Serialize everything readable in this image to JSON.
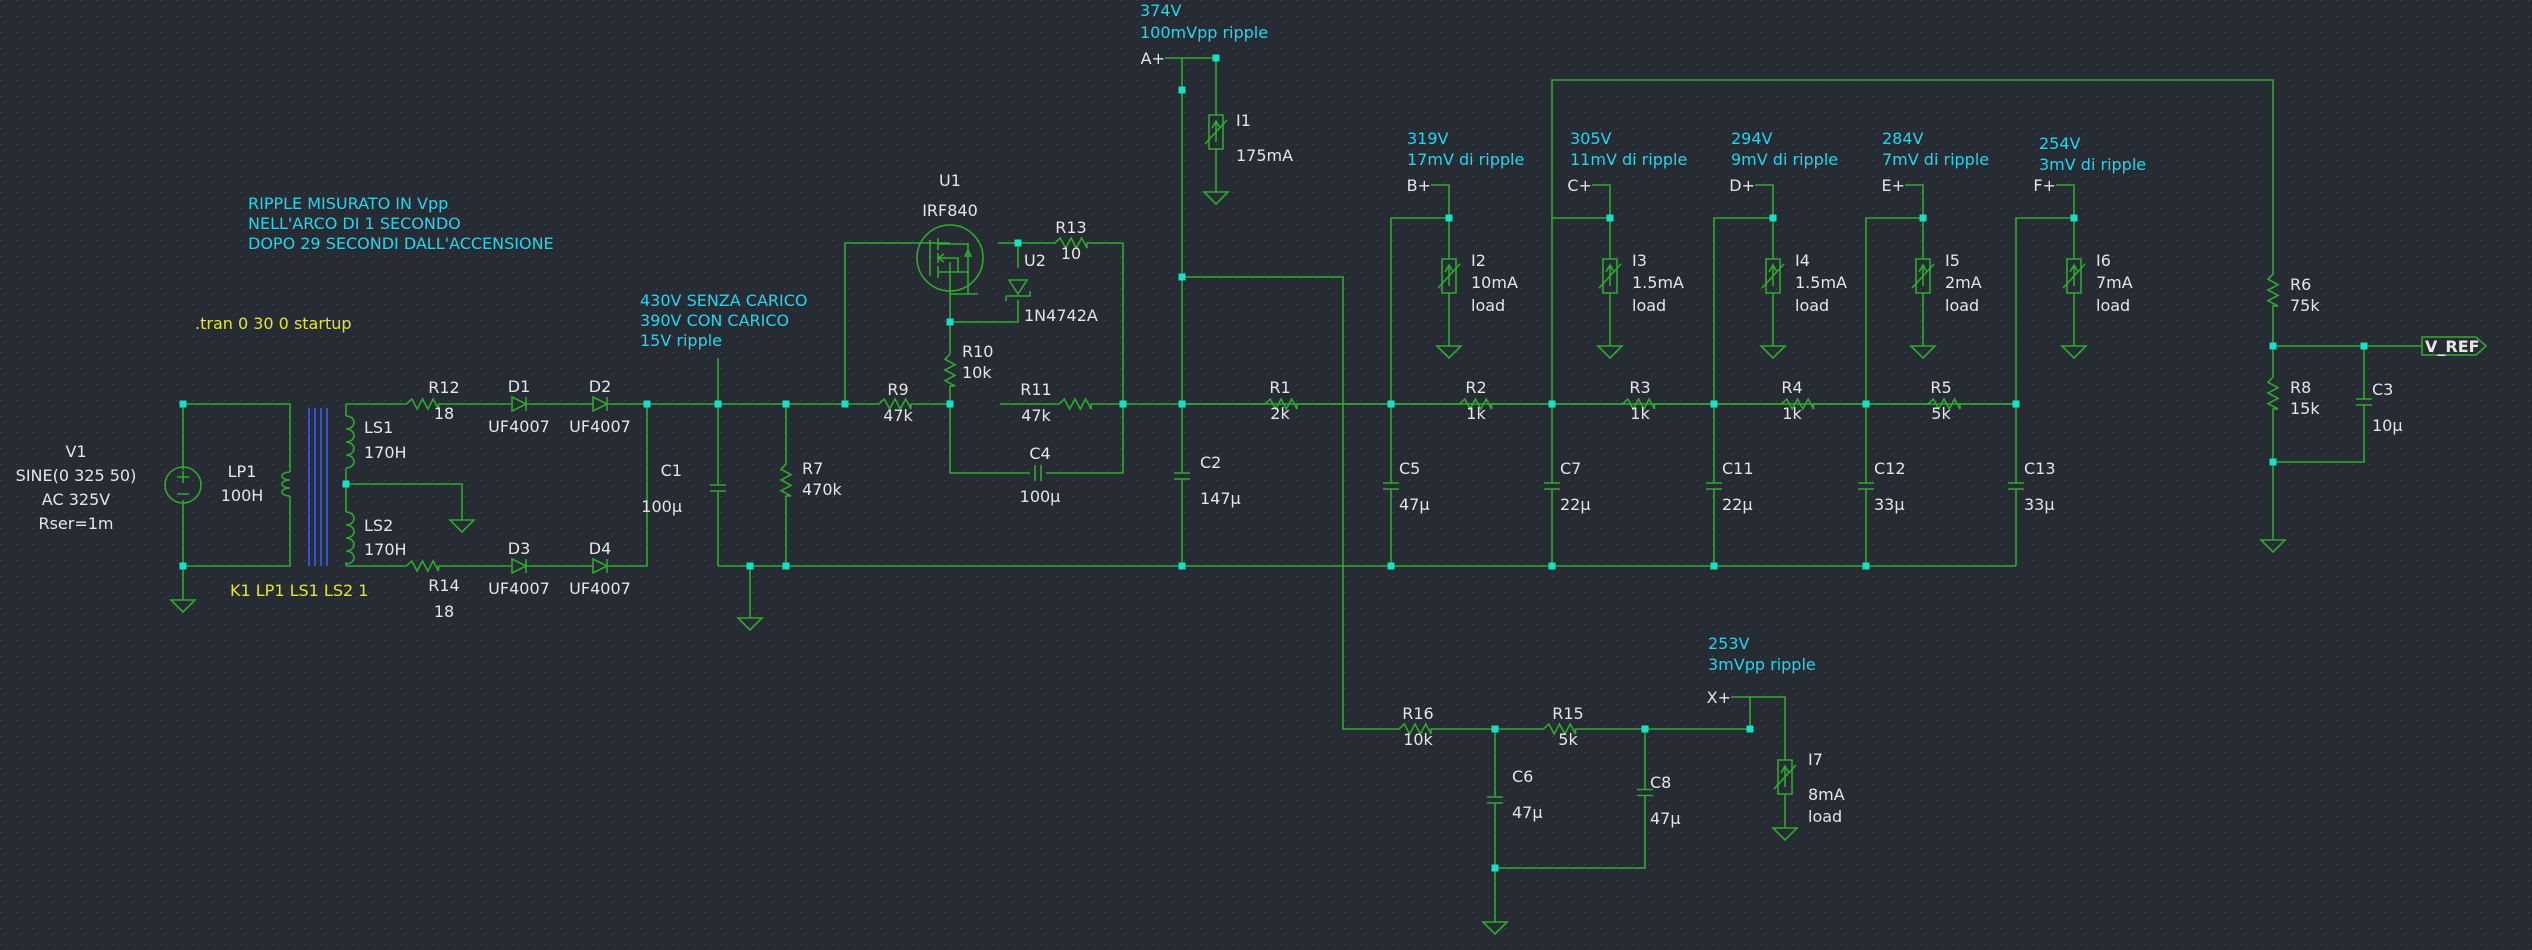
{
  "colors": {
    "background": "#272b33",
    "grid": "#3c424c",
    "wire": "#2eaa2e",
    "node": "#18e0c8",
    "label": "#e6e6e6",
    "note_cyan": "#22d6ee",
    "note_yellow": "#e6e62a",
    "transformer_core": "#3355cc"
  },
  "components": {
    "V1": {
      "name": "V1",
      "l1": "SINE(0 325 50)",
      "l2": "AC 325V",
      "l3": "Rser=1m"
    },
    "LP1": {
      "name": "LP1",
      "value": "100H"
    },
    "LS1": {
      "name": "LS1",
      "value": "170H"
    },
    "LS2": {
      "name": "LS2",
      "value": "170H"
    },
    "R12": {
      "name": "R12",
      "value": "18"
    },
    "R14": {
      "name": "R14",
      "value": "18"
    },
    "D1": {
      "name": "D1",
      "value": "UF4007"
    },
    "D2": {
      "name": "D2",
      "value": "UF4007"
    },
    "D3": {
      "name": "D3",
      "value": "UF4007"
    },
    "D4": {
      "name": "D4",
      "value": "UF4007"
    },
    "C1": {
      "name": "C1",
      "value": "100µ"
    },
    "R7": {
      "name": "R7",
      "value": "470k"
    },
    "R9": {
      "name": "R9",
      "value": "47k"
    },
    "R10": {
      "name": "R10",
      "value": "10k"
    },
    "R11": {
      "name": "R11",
      "value": "47k"
    },
    "R13": {
      "name": "R13",
      "value": "10"
    },
    "C4": {
      "name": "C4",
      "value": "100µ"
    },
    "U1": {
      "name": "U1",
      "value": "IRF840"
    },
    "U2": {
      "name": "U2",
      "value": "1N4742A"
    },
    "C2": {
      "name": "C2",
      "value": "147µ"
    },
    "R1": {
      "name": "R1",
      "value": "2k"
    },
    "R2": {
      "name": "R2",
      "value": "1k"
    },
    "R3": {
      "name": "R3",
      "value": "1k"
    },
    "R4": {
      "name": "R4",
      "value": "1k"
    },
    "R5": {
      "name": "R5",
      "value": "5k"
    },
    "C5": {
      "name": "C5",
      "value": "47µ"
    },
    "C7": {
      "name": "C7",
      "value": "22µ"
    },
    "C11": {
      "name": "C11",
      "value": "22µ"
    },
    "C12": {
      "name": "C12",
      "value": "33µ"
    },
    "C13": {
      "name": "C13",
      "value": "33µ"
    },
    "I1": {
      "name": "I1",
      "value": "175mA"
    },
    "I2": {
      "name": "I2",
      "l1": "10mA",
      "l2": "load"
    },
    "I3": {
      "name": "I3",
      "l1": "1.5mA",
      "l2": "load"
    },
    "I4": {
      "name": "I4",
      "l1": "1.5mA",
      "l2": "load"
    },
    "I5": {
      "name": "I5",
      "l1": "2mA",
      "l2": "load"
    },
    "I6": {
      "name": "I6",
      "l1": "7mA",
      "l2": "load"
    },
    "I7": {
      "name": "I7",
      "l1": "8mA",
      "l2": "load"
    },
    "R6": {
      "name": "R6",
      "value": "75k"
    },
    "R8": {
      "name": "R8",
      "value": "15k"
    },
    "C3": {
      "name": "C3",
      "value": "10µ"
    },
    "R16": {
      "name": "R16",
      "value": "10k"
    },
    "R15": {
      "name": "R15",
      "value": "5k"
    },
    "C6": {
      "name": "C6",
      "value": "47µ"
    },
    "C8": {
      "name": "C8",
      "value": "47µ"
    }
  },
  "nets": {
    "A": "A+",
    "B": "B+",
    "C": "C+",
    "D": "D+",
    "E": "E+",
    "F": "F+",
    "X": "X+",
    "VREF": "V_REF"
  },
  "notes": {
    "ripple": [
      "RIPPLE MISURATO IN Vpp",
      "NELL'ARCO DI 1 SECONDO",
      "DOPO 29 SECONDI DALL'ACCENSIONE"
    ],
    "tran": ".tran 0 30 0 startup",
    "k1": "K1 LP1 LS1 LS2 1",
    "c1": [
      "430V SENZA CARICO",
      "390V CON CARICO",
      "15V ripple"
    ],
    "A": [
      "374V",
      "100mVpp ripple"
    ],
    "B": [
      "319V",
      "17mV di ripple"
    ],
    "C": [
      "305V",
      "11mV di ripple"
    ],
    "D": [
      "294V",
      "9mV di ripple"
    ],
    "E": [
      "284V",
      "7mV di ripple"
    ],
    "F": [
      "254V",
      "3mV di ripple"
    ],
    "X": [
      "253V",
      "3mVpp ripple"
    ]
  }
}
